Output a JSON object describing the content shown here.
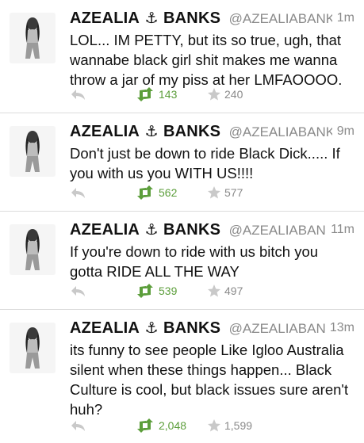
{
  "tweets": [
    {
      "name": "AZEALIA",
      "anchor": "⚓",
      "name2": "BANKS",
      "handle": "@AZEALIABANKS",
      "time": "1m",
      "text": "LOL... IM PETTY, but its so true, ugh, that wannabe black girl shit makes me wanna throw a jar of my piss at her LMFAOOOO.",
      "retweets": "143",
      "favorites": "240"
    },
    {
      "name": "AZEALIA",
      "anchor": "⚓",
      "name2": "BANKS",
      "handle": "@AZEALIABANKS",
      "time": "9m",
      "text": "Don't just be down to ride Black Dick..... If you with us you WITH US!!!!",
      "retweets": "562",
      "favorites": "577"
    },
    {
      "name": "AZEALIA",
      "anchor": "⚓",
      "name2": "BANKS",
      "handle": "@AZEALIABAN...",
      "time": "11m",
      "text": "If you're down to ride with us bitch you gotta RIDE ALL THE WAY",
      "retweets": "539",
      "favorites": "497"
    },
    {
      "name": "AZEALIA",
      "anchor": "⚓",
      "name2": "BANKS",
      "handle": "@AZEALIABAN...",
      "time": "13m",
      "text": "its funny to see people Like Igloo Australia silent when these things happen... Black Culture is cool, but black issues sure aren't huh?",
      "retweets": "2,048",
      "favorites": "1,599"
    }
  ],
  "colors": {
    "retweet": "#5c9e3b",
    "muted": "#8a8a8a",
    "divider": "#dcdcdc"
  },
  "icons": {
    "reply": "reply-icon",
    "retweet": "retweet-icon",
    "favorite": "star-icon",
    "anchor": "anchor-icon",
    "avatar": "avatar-photo"
  }
}
